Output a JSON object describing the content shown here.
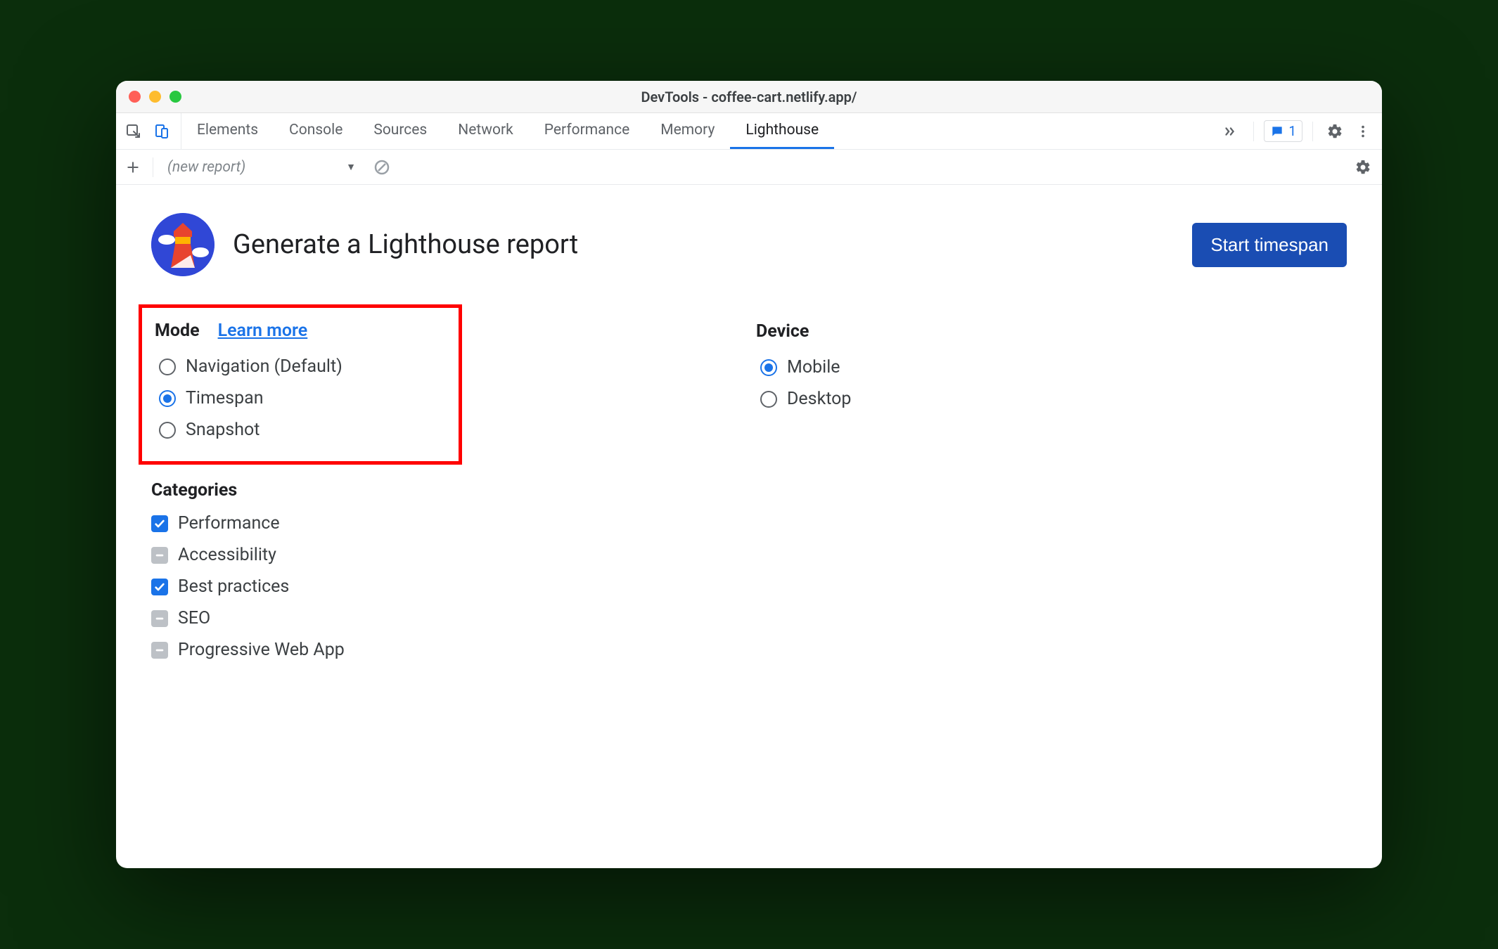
{
  "titlebar": {
    "title": "DevTools - coffee-cart.netlify.app/"
  },
  "tabs": {
    "items": [
      "Elements",
      "Console",
      "Sources",
      "Network",
      "Performance",
      "Memory",
      "Lighthouse"
    ],
    "active": "Lighthouse",
    "badge_count": "1"
  },
  "subbar": {
    "dropdown_label": "(new report)"
  },
  "header": {
    "title": "Generate a Lighthouse report",
    "button": "Start timespan"
  },
  "mode": {
    "heading": "Mode",
    "learn_more": "Learn more",
    "options": [
      {
        "label": "Navigation (Default)",
        "checked": false
      },
      {
        "label": "Timespan",
        "checked": true
      },
      {
        "label": "Snapshot",
        "checked": false
      }
    ]
  },
  "device": {
    "heading": "Device",
    "options": [
      {
        "label": "Mobile",
        "checked": true
      },
      {
        "label": "Desktop",
        "checked": false
      }
    ]
  },
  "categories": {
    "heading": "Categories",
    "options": [
      {
        "label": "Performance",
        "state": "on"
      },
      {
        "label": "Accessibility",
        "state": "mixed"
      },
      {
        "label": "Best practices",
        "state": "on"
      },
      {
        "label": "SEO",
        "state": "mixed"
      },
      {
        "label": "Progressive Web App",
        "state": "mixed"
      }
    ]
  }
}
